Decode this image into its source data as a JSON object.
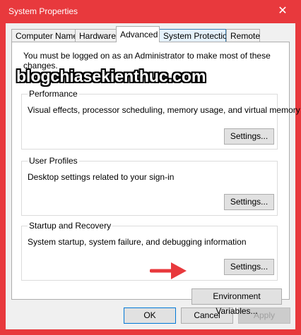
{
  "window": {
    "title": "System Properties",
    "close_glyph": "✕"
  },
  "tabs": [
    {
      "label": "Computer Name"
    },
    {
      "label": "Hardware"
    },
    {
      "label": "Advanced"
    },
    {
      "label": "System Protection"
    },
    {
      "label": "Remote"
    }
  ],
  "active_tab": "Advanced",
  "notice": "You must be logged on as an Administrator to make most of these changes.",
  "performance": {
    "title": "Performance",
    "description": "Visual effects, processor scheduling, memory usage, and virtual memory",
    "button": "Settings..."
  },
  "user_profiles": {
    "title": "User Profiles",
    "description": "Desktop settings related to your sign-in",
    "button": "Settings..."
  },
  "startup_recovery": {
    "title": "Startup and Recovery",
    "description": "System startup, system failure, and debugging information",
    "button": "Settings..."
  },
  "env_button": "Environment Variables...",
  "watermark": "blogchiasekienthuc.com",
  "footer": {
    "ok": "OK",
    "cancel": "Cancel",
    "apply": "Apply"
  },
  "colors": {
    "window_frame": "#e8393d",
    "arrow": "#e8393d",
    "focus_border": "#0078d7"
  },
  "icons": {
    "close": "close-icon",
    "arrow": "red-arrow-icon"
  }
}
